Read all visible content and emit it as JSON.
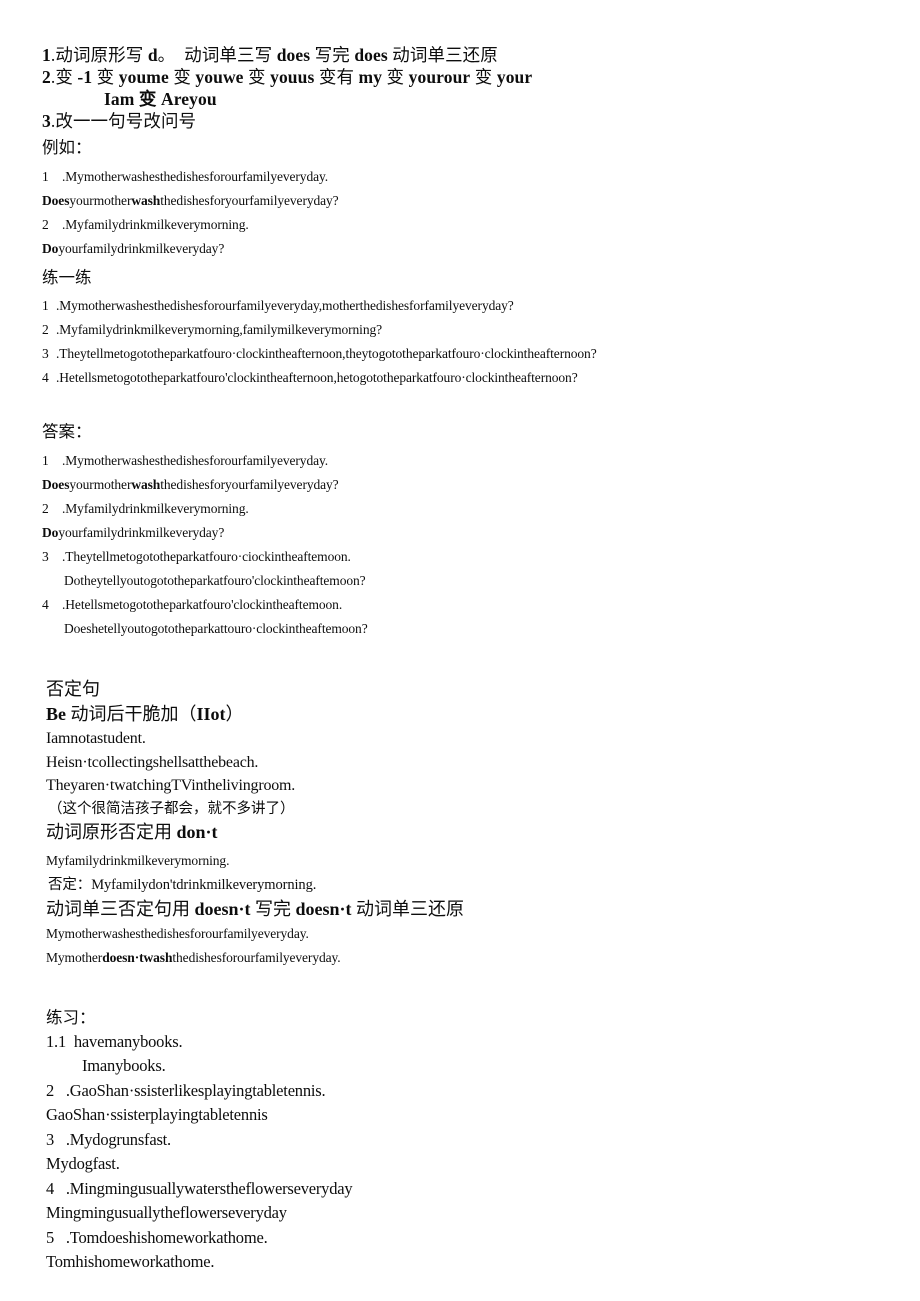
{
  "document": {
    "rules": [
      {
        "num": "1",
        "sep": ".",
        "text_a": "动词原形写 ",
        "bold_a": "d",
        "text_b": "。  动词单三写 ",
        "bold_b": "does",
        "text_c": " 写完 ",
        "bold_c": "does",
        "text_d": " 动词单三还原"
      },
      {
        "num": "2",
        "sep": ".",
        "line": "变 -1 变 youme 变 youwe 变 youus 变有 my 变 yourour 变 your"
      },
      {
        "num": "3",
        "sep": ".",
        "line": "改一一句号改问号"
      }
    ],
    "rule2_prefix": "变 ",
    "rule2_bold1": "-1",
    "rule2_mid1": " 变 ",
    "rule2_bold2": "youme",
    "rule2_mid2": " 变 ",
    "rule2_bold3": "youwe",
    "rule2_mid3": " 变 ",
    "rule2_bold4": "youus",
    "rule2_mid4": " 变有 ",
    "rule2_bold5": "my",
    "rule2_mid5": " 变 ",
    "rule2_bold6": "yourour",
    "rule2_mid6": " 变 ",
    "rule2_bold7": "your",
    "rule2_indent_line": "Iam 变 Areyou",
    "rule3_text": "改一一句号改问号",
    "example_heading": "例如：",
    "examples": [
      {
        "idx": "1",
        "text": ".Mymotherwashesthedishesforourfamilyeveryday."
      },
      {
        "idx": "",
        "bold1": "Does",
        "plain1": "yourmother",
        "bold2": "wash",
        "plain2": "thedishesforyourfamilyeveryday?"
      },
      {
        "idx": "2",
        "text": ".Myfamilydrinkmilkeverymorning."
      },
      {
        "idx": "",
        "bold1": "Do",
        "plain1": "yourfamilydrinkmilkeveryday?"
      }
    ],
    "practice_heading": "练一练",
    "practice_items": [
      {
        "idx": "1",
        "text": ".Mymotherwashesthedishesforourfamilyeveryday,motherthedishesforfamilyeveryday?"
      },
      {
        "idx": "2",
        "text": ".Myfamilydrinkmilkeverymorning,familymilkeverymorning?"
      },
      {
        "idx": "3",
        "text": ".Theytellmetogototheparkatfouro·clockintheafternoon,theytogototheparkatfouro·clockintheafternoon?"
      },
      {
        "idx": "4",
        "text": ".Hetellsmetogototheparkatfouro'clockintheafternoon,hetogototheparkatfouro·clockintheafternoon?"
      }
    ],
    "answers_heading": "答案：",
    "answers": [
      {
        "idx": "1",
        "text": ".Mymotherwashesthedishesforourfamilyeveryday."
      },
      {
        "idx": "",
        "bold1": "Does",
        "plain1": "yourmother",
        "bold2": "wash",
        "plain2": "thedishesforyourfamilyeveryday?"
      },
      {
        "idx": "2",
        "text": ".Myfamilydrinkmilkeverymorning."
      },
      {
        "idx": "",
        "bold1": "Do",
        "plain1": "yourfamilydrinkmilkeveryday?"
      },
      {
        "idx": "3",
        "text": ".Theytellmetogototheparkatfouro·ciockintheaftemoon."
      },
      {
        "idx": "",
        "indent": "Dotheytellyoutogototheparkatfouro'clockintheaftemoon?"
      },
      {
        "idx": "4",
        "text": ".Hetellsmetogototheparkatfouro'clockintheaftemoon."
      },
      {
        "idx": "",
        "indent": "Doeshetellyoutogototheparkattouro·clockintheaftemoon?"
      }
    ],
    "negative": {
      "heading": "否定句",
      "rule_bold_be": "Be",
      "rule_cjk": " 动词后干脆加（",
      "rule_bold_not": "IIot",
      "rule_cjk_end": "）",
      "sentences": [
        "Iamnotastudent.",
        "Heisn·tcollectingshellsatthebeach.",
        "Theyaren·twatchingTVinthelivingroom."
      ],
      "note": "（这个很简洁孩子都会，就不多讲了）",
      "dont_rule_cjk": "动词原形否定用 ",
      "dont_rule_bold": "don·t",
      "dont_example": "Myfamilydrinkmilkeverymorning.",
      "dont_answer": "否定：Myfamilydon'tdrinkmilkeverymorning.",
      "doesnt_rule_a": "动词单三否定句用 ",
      "doesnt_rule_b1": "doesn·t",
      "doesnt_rule_c": " 写完 ",
      "doesnt_rule_b2": "doesn·t",
      "doesnt_rule_d": " 动词单三还原",
      "doesnt_example": "Mymotherwashesthedishesforourfamilyeveryday.",
      "doesnt_answer_plain1": "Mymother",
      "doesnt_answer_bold": "doesn·twash",
      "doesnt_answer_plain2": "thedishesforourfamilyeveryday."
    },
    "exercise": {
      "heading": "练习：",
      "items": [
        {
          "q": "1.1  havemanybooks.",
          "a": "Imanybooks.",
          "a_indent": true
        },
        {
          "q": "2   .GaoShan·ssisterlikesplayingtabletennis.",
          "a": "GaoShan·ssisterplayingtabletennis",
          "a_indent": false
        },
        {
          "q": "3   .Mydogrunsfast.",
          "a": "Mydogfast.",
          "a_indent": false
        },
        {
          "q": "4   .Mingmingusuallywaterstheflowerseveryday",
          "a": "Mingmingusuallytheflowerseveryday",
          "a_indent": false
        },
        {
          "q": "5   .Tomdoeshishomeworkathome.",
          "a": "Tomhishomeworkathome.",
          "a_indent": false
        }
      ]
    }
  }
}
